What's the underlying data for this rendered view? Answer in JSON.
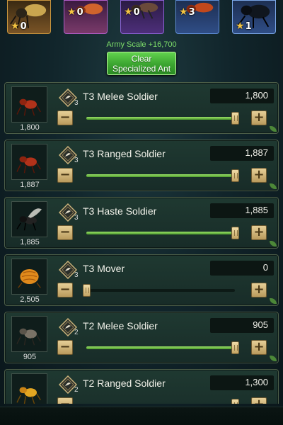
{
  "top_cards": [
    {
      "count": "0",
      "color": "#a8752c"
    },
    {
      "count": "0",
      "color": "#6a2c8c"
    },
    {
      "count": "0",
      "color": "#5b3c8d"
    },
    {
      "count": "3",
      "color": "#2f5ea6"
    },
    {
      "count": "1",
      "color": "#2f5ea6"
    }
  ],
  "army_scale": "Army Scale +16,700",
  "clear_button": {
    "line1": "Clear",
    "line2": "Specialized Ant"
  },
  "units": [
    {
      "name": "T3 Melee Soldier",
      "count": "1,800",
      "value": "1,800",
      "skill_level": "3",
      "fill": 1.0,
      "icon": "red-ant-icon"
    },
    {
      "name": "T3 Ranged Soldier",
      "count": "1,887",
      "value": "1,887",
      "skill_level": "3",
      "fill": 1.0,
      "icon": "red-ant-icon"
    },
    {
      "name": "T3 Haste Soldier",
      "count": "1,885",
      "value": "1,885",
      "skill_level": "3",
      "fill": 1.0,
      "icon": "winged-ant-icon"
    },
    {
      "name": "T3 Mover",
      "count": "2,505",
      "value": "0",
      "skill_level": "3",
      "fill": 0.0,
      "icon": "mover-ant-icon"
    },
    {
      "name": "T2 Melee Soldier",
      "count": "905",
      "value": "905",
      "skill_level": "2",
      "fill": 1.0,
      "icon": "gray-ant-icon"
    },
    {
      "name": "T2 Ranged Soldier",
      "count": "",
      "value": "1,300",
      "skill_level": "2",
      "fill": 1.0,
      "icon": "yellow-ant-icon"
    }
  ]
}
